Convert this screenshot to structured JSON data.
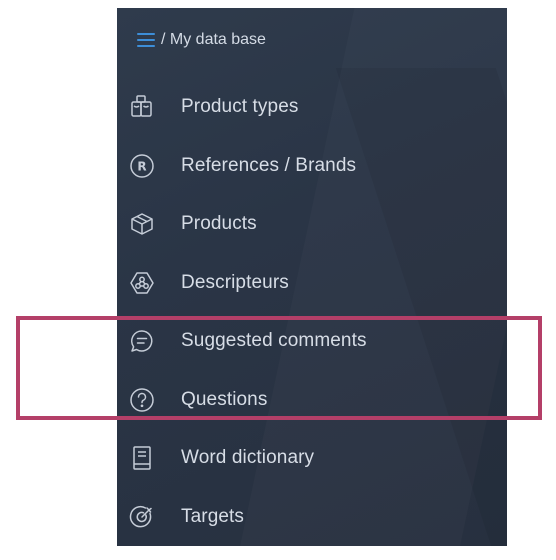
{
  "breadcrumb": {
    "menu_icon": "hamburger-icon",
    "text": "/ My data base"
  },
  "menu": {
    "items": [
      {
        "label": "Product types",
        "icon": "product-types-icon"
      },
      {
        "label": "References / Brands",
        "icon": "registered-icon"
      },
      {
        "label": "Products",
        "icon": "box-icon"
      },
      {
        "label": "Descripteurs",
        "icon": "descriptors-icon"
      },
      {
        "label": "Suggested comments",
        "icon": "comment-icon"
      },
      {
        "label": "Questions",
        "icon": "question-icon"
      },
      {
        "label": "Word dictionary",
        "icon": "book-icon"
      },
      {
        "label": "Targets",
        "icon": "target-icon"
      }
    ]
  },
  "colors": {
    "panel_bg": "#2b3647",
    "text": "#d7dde6",
    "accent": "#3d8ed8",
    "highlight_border": "#b43f68"
  }
}
